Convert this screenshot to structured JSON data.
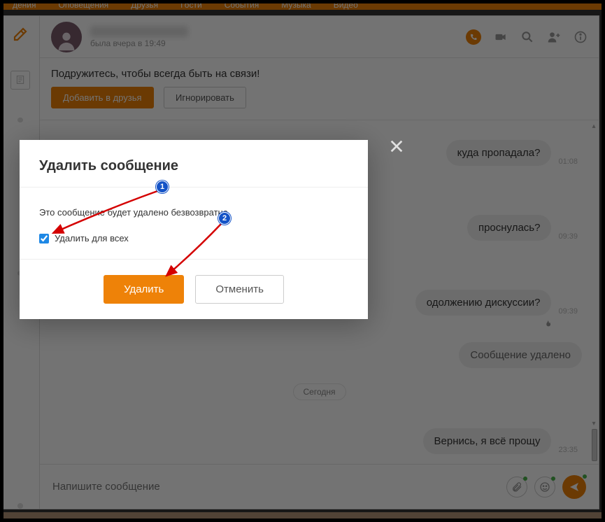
{
  "topnav": {
    "items": [
      "дения",
      "Оповещения",
      "Друзья",
      "Гости",
      "События",
      "Музыка",
      "Видео"
    ]
  },
  "header": {
    "name_hidden": true,
    "last_seen": "была вчера в 19:49"
  },
  "friend_prompt": {
    "text": "Подружитесь, чтобы всегда быть на связи!",
    "add": "Добавить в друзья",
    "ignore": "Игнорировать"
  },
  "messages": [
    {
      "text": "куда пропадала?",
      "time": "01:08"
    },
    {
      "text": "проснулась?",
      "time": "09:39"
    },
    {
      "text": "одолжению дискуссии?",
      "time": "09:39",
      "flame": true
    },
    {
      "text": "Сообщение удалено",
      "time": "",
      "deleted": true
    },
    {
      "date_separator": "Сегодня"
    },
    {
      "text": "Вернись, я всё прощу",
      "time": "23:35",
      "last": true
    }
  ],
  "composer": {
    "placeholder": "Напишите сообщение"
  },
  "modal": {
    "title": "Удалить сообщение",
    "body_text": "Это сообщение будет удалено безвозвратно.",
    "checkbox_label": "Удалить для всех",
    "checkbox_checked": true,
    "confirm": "Удалить",
    "cancel": "Отменить"
  },
  "annotations": {
    "badge1": "1",
    "badge2": "2"
  }
}
